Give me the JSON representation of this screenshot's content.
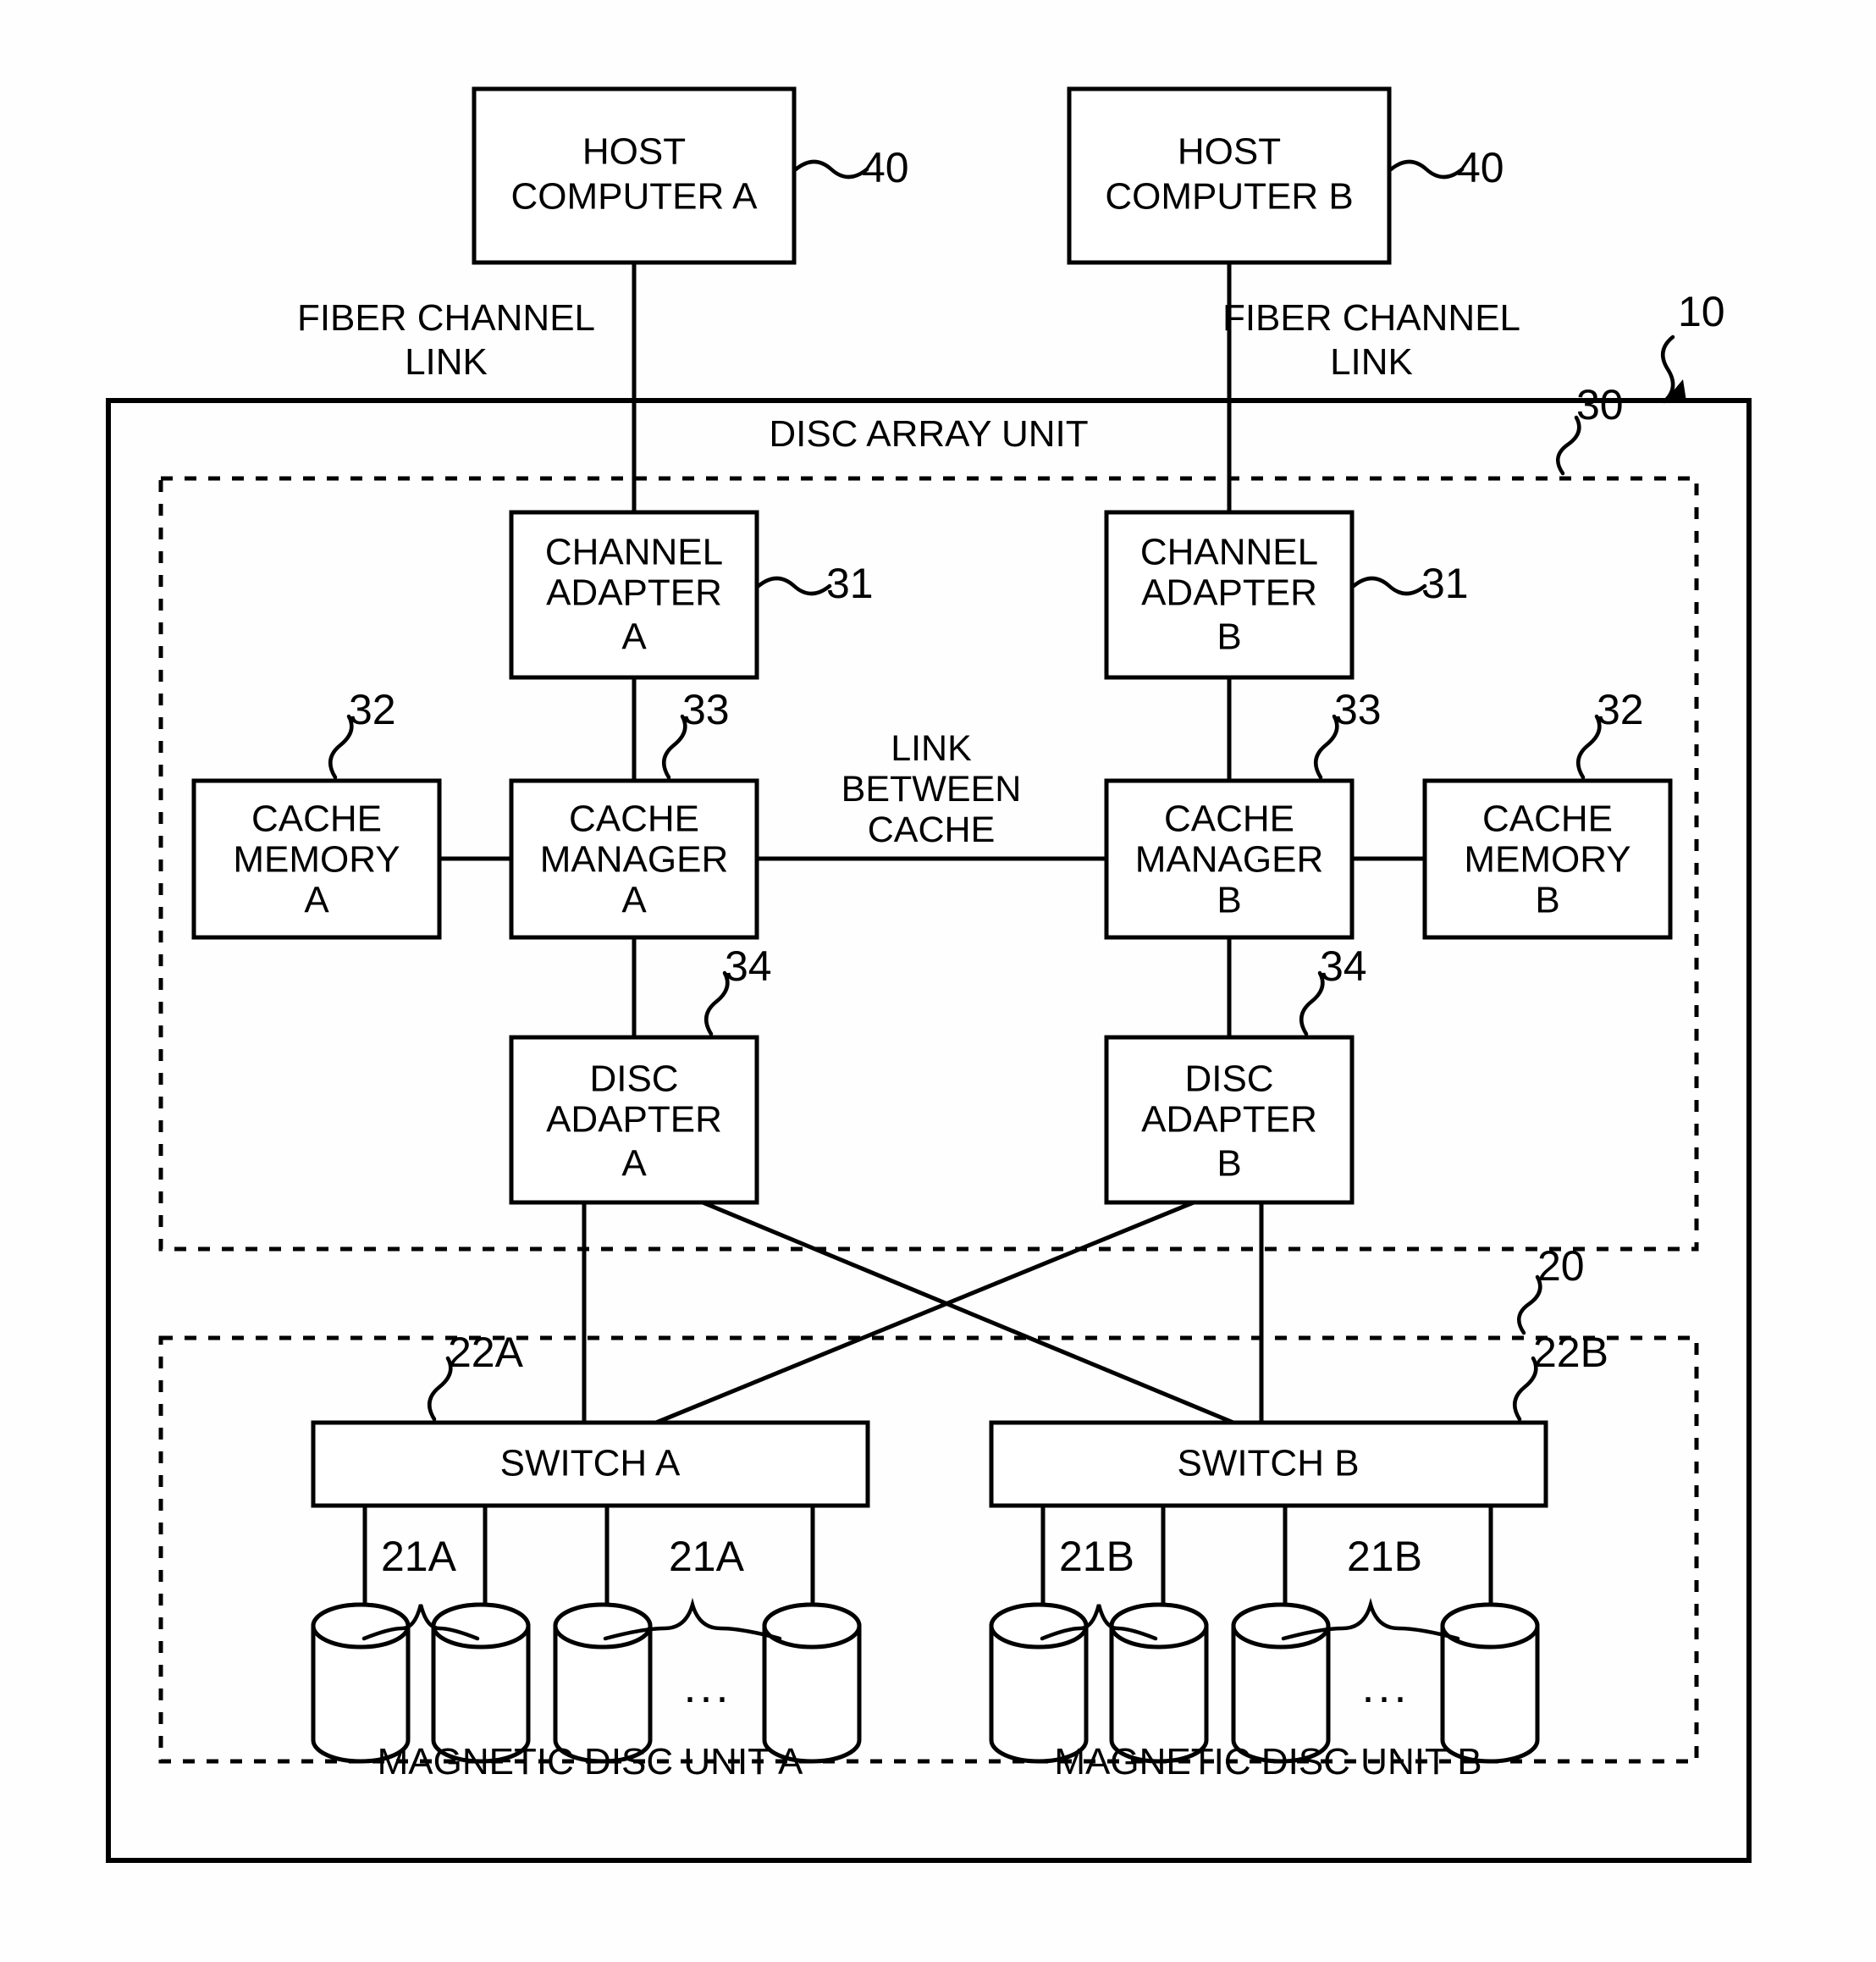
{
  "figure": {
    "title": "DISC ARRAY UNIT",
    "type": "patent-block-diagram"
  },
  "hosts": [
    {
      "line1": "HOST",
      "line2": "COMPUTER A",
      "ref": "40",
      "link_label_line1": "FIBER CHANNEL",
      "link_label_line2": "LINK"
    },
    {
      "line1": "HOST",
      "line2": "COMPUTER B",
      "ref": "40",
      "link_label_line1": "FIBER CHANNEL",
      "link_label_line2": "LINK"
    }
  ],
  "disc_array_unit": {
    "label": "DISC ARRAY UNIT",
    "ref": "10",
    "controller": {
      "ref": "30",
      "channel_adapters": [
        {
          "line1": "CHANNEL",
          "line2": "ADAPTER",
          "line3": "A",
          "ref": "31"
        },
        {
          "line1": "CHANNEL",
          "line2": "ADAPTER",
          "line3": "B",
          "ref": "31"
        }
      ],
      "cache_memories": [
        {
          "line1": "CACHE",
          "line2": "MEMORY",
          "line3": "A",
          "ref": "32"
        },
        {
          "line1": "CACHE",
          "line2": "MEMORY",
          "line3": "B",
          "ref": "32"
        }
      ],
      "cache_managers": [
        {
          "line1": "CACHE",
          "line2": "MANAGER",
          "line3": "A",
          "ref": "33"
        },
        {
          "line1": "CACHE",
          "line2": "MANAGER",
          "line3": "B",
          "ref": "33"
        }
      ],
      "cache_link_label": {
        "line1": "LINK",
        "line2": "BETWEEN",
        "line3": "CACHE"
      },
      "disc_adapters": [
        {
          "line1": "DISC",
          "line2": "ADAPTER",
          "line3": "A",
          "ref": "34"
        },
        {
          "line1": "DISC",
          "line2": "ADAPTER",
          "line3": "B",
          "ref": "34"
        }
      ]
    },
    "storage": {
      "ref": "20",
      "switches": [
        {
          "label": "SWITCH A",
          "ref": "22A"
        },
        {
          "label": "SWITCH B",
          "ref": "22B"
        }
      ],
      "disc_units": [
        {
          "label": "MAGNETIC DISC UNIT A",
          "disc_ref_left": "21A",
          "disc_ref_right": "21A",
          "ellipsis": "...",
          "disc_count_shown": 4
        },
        {
          "label": "MAGNETIC DISC UNIT B",
          "disc_ref_left": "21B",
          "disc_ref_right": "21B",
          "ellipsis": "...",
          "disc_count_shown": 4
        }
      ]
    }
  },
  "colors": {
    "ink": "#000000",
    "paper": "#ffffff"
  }
}
